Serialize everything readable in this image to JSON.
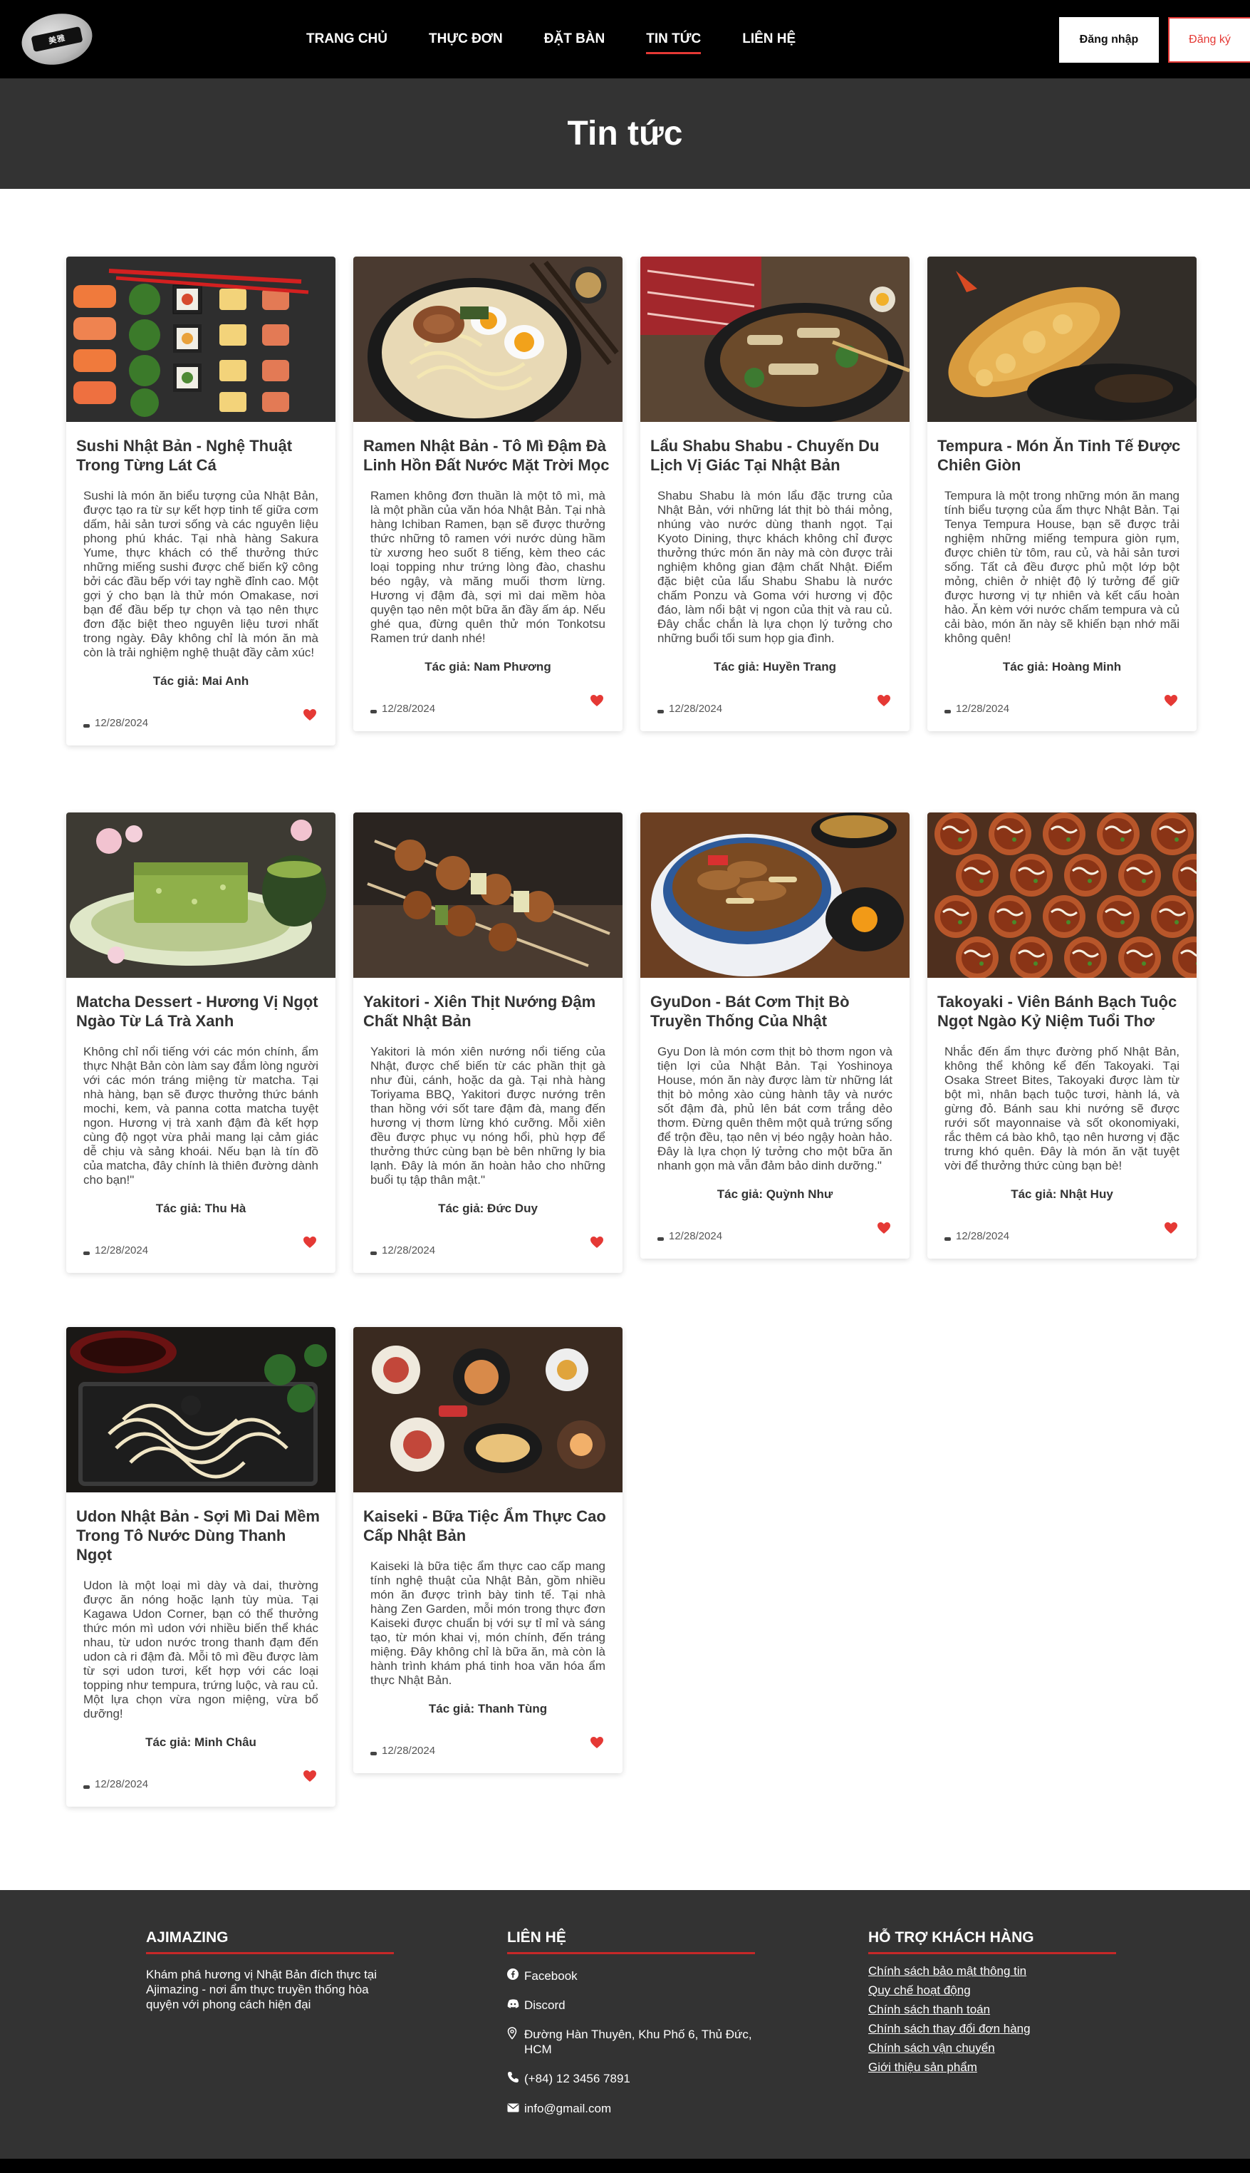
{
  "nav": {
    "logo_text": "美雅",
    "links": [
      "TRANG CHỦ",
      "THỰC ĐƠN",
      "ĐẶT BÀN",
      "TIN TỨC",
      "LIÊN HỆ"
    ],
    "active": "TIN TỨC",
    "login_label": "Đăng nhập",
    "register_label": "Đăng ký"
  },
  "hero": {
    "title": "Tin tức"
  },
  "colors": {
    "accent": "#e53935",
    "dark": "#333333",
    "black": "#000000"
  },
  "articles": [
    {
      "title": "Sushi Nhật Bản - Nghệ Thuật Trong Từng Lát Cá",
      "desc": "Sushi là món ăn biểu tượng của Nhật Bản, được tạo ra từ sự kết hợp tinh tế giữa cơm dấm, hải sản tươi sống và các nguyên liệu phong phú khác. Tại nhà hàng Sakura Yume, thực khách có thể thưởng thức những miếng sushi được chế biến kỹ công bởi các đầu bếp với tay nghề đỉnh cao. Một gợi ý cho bạn là thử món Omakase, nơi bạn để đầu bếp tự chọn và tạo nên thực đơn đặc biệt theo nguyên liệu tươi nhất trong ngày. Đây không chỉ là món ăn mà còn là trải nghiệm nghệ thuật đầy cảm xúc!",
      "author": "Tác giả: Mai Anh",
      "date": "12/28/2024",
      "image": "sushi-platter"
    },
    {
      "title": "Ramen Nhật Bản - Tô Mì Đậm Đà Linh Hồn Đất Nước Mặt Trời Mọc",
      "desc": "Ramen không đơn thuần là một tô mì, mà là một phần của văn hóa Nhật Bản. Tại nhà hàng Ichiban Ramen, bạn sẽ được thưởng thức những tô ramen với nước dùng hầm từ xương heo suốt 8 tiếng, kèm theo các loại topping như trứng lòng đào, chashu béo ngậy, và măng muối thơm lừng. Hương vị đậm đà, sợi mì dai mềm hòa quyện tạo nên một bữa ăn đầy ấm áp. Nếu ghé qua, đừng quên thử món Tonkotsu Ramen trứ danh nhé!",
      "author": "Tác giả: Nam Phương",
      "date": "12/28/2024",
      "image": "ramen-bowl"
    },
    {
      "title": "Lẩu Shabu Shabu - Chuyến Du Lịch Vị Giác Tại Nhật Bản",
      "desc": "Shabu Shabu là món lẩu đặc trưng của Nhật Bản, với những lát thịt bò thái mỏng, nhúng vào nước dùng thanh ngọt. Tại Kyoto Dining, thực khách không chỉ được thưởng thức món ăn này mà còn được trải nghiệm không gian đậm chất Nhật. Điểm đặc biệt của lẩu Shabu Shabu là nước chấm Ponzu và Goma với hương vị độc đáo, làm nổi bật vị ngon của thịt và rau củ. Đây chắc chắn là lựa chọn lý tưởng cho những buổi tối sum họp gia đình.",
      "author": "Tác giả: Huyền Trang",
      "date": "12/28/2024",
      "image": "shabu-hotpot"
    },
    {
      "title": "Tempura - Món Ăn Tinh Tế Được Chiên Giòn",
      "desc": "Tempura là một trong những món ăn mang tính biểu tượng của ẩm thực Nhật Bản. Tại Tenya Tempura House, bạn sẽ được trải nghiệm những miếng tempura giòn rụm, được chiên từ tôm, rau củ, và hải sản tươi sống. Tất cả đều được phủ một lớp bột mỏng, chiên ở nhiệt độ lý tưởng để giữ được hương vị tự nhiên và kết cấu hoàn hảo. Ăn kèm với nước chấm tempura và củ cải bào, món ăn này sẽ khiến bạn nhớ mãi không quên!",
      "author": "Tác giả: Hoàng Minh",
      "date": "12/28/2024",
      "image": "tempura-shrimp"
    },
    {
      "title": "Matcha Dessert - Hương Vị Ngọt Ngào Từ Lá Trà Xanh",
      "desc": "Không chỉ nổi tiếng với các món chính, ẩm thực Nhật Bản còn làm say đắm lòng người với các món tráng miệng từ matcha. Tại nhà hàng, bạn sẽ được thưởng thức bánh mochi, kem, và panna cotta matcha tuyệt ngon. Hương vị trà xanh đậm đà kết hợp cùng độ ngọt vừa phải mang lại cảm giác dễ chịu và sảng khoái. Nếu bạn là tín đồ của matcha, đây chính là thiên đường dành cho bạn!\"",
      "author": "Tác giả: Thu Hà",
      "date": "12/28/2024",
      "image": "matcha-cake"
    },
    {
      "title": "Yakitori - Xiên Thịt Nướng Đậm Chất Nhật Bản",
      "desc": "Yakitori là món xiên nướng nổi tiếng của Nhật, được chế biến từ các phần thịt gà như đùi, cánh, hoặc da gà. Tại nhà hàng Toriyama BBQ, Yakitori được nướng trên than hồng với sốt tare đậm đà, mang đến hương vị thơm lừng khó cưỡng. Mỗi xiên đều được phục vụ nóng hổi, phù hợp để thưởng thức cùng bạn bè bên những ly bia lạnh. Đây là món ăn hoàn hảo cho những buổi tụ tập thân mật.\"",
      "author": "Tác giả: Đức Duy",
      "date": "12/28/2024",
      "image": "yakitori-skewers"
    },
    {
      "title": "GyuDon - Bát Cơm Thịt Bò Truyền Thống Của Nhật",
      "desc": "Gyu Don là món cơm thịt bò thơm ngon và tiện lợi của Nhật Bản. Tại Yoshinoya House, món ăn này được làm từ những lát thịt bò mỏng xào cùng hành tây và nước sốt đậm đà, phủ lên bát cơm trắng dẻo thơm. Đừng quên thêm một quả trứng sống để trộn đều, tạo nên vị béo ngậy hoàn hảo. Đây là lựa chọn lý tưởng cho một bữa ăn nhanh gọn mà vẫn đảm bảo dinh dưỡng.\"",
      "author": "Tác giả: Quỳnh Như",
      "date": "12/28/2024",
      "image": "gyudon-bowl"
    },
    {
      "title": "Takoyaki - Viên Bánh Bạch Tuộc Ngọt Ngào Kỷ Niệm Tuổi Thơ",
      "desc": "Nhắc đến ẩm thực đường phố Nhật Bản, không thể không kể đến Takoyaki. Tại Osaka Street Bites, Takoyaki được làm từ bột mì, nhân bạch tuộc tươi, hành lá, và gừng đỏ. Bánh sau khi nướng sẽ được rưới sốt mayonnaise và sốt okonomiyaki, rắc thêm cá bào khô, tạo nên hương vị đặc trưng khó quên. Đây là món ăn vặt tuyệt vời để thưởng thức cùng bạn bè!",
      "author": "Tác giả: Nhật Huy",
      "date": "12/28/2024",
      "image": "takoyaki-balls"
    },
    {
      "title": "Udon Nhật Bản - Sợi Mì Dai Mềm Trong Tô Nước Dùng Thanh Ngọt",
      "desc": "Udon là một loại mì dày và dai, thường được ăn nóng hoặc lạnh tùy mùa. Tại Kagawa Udon Corner, bạn có thể thưởng thức món mì udon với nhiều biến thể khác nhau, từ udon nước trong thanh đạm đến udon cà ri đậm đà. Mỗi tô mì đều được làm từ sợi udon tươi, kết hợp với các loại topping như tempura, trứng luộc, và rau củ. Một lựa chọn vừa ngon miệng, vừa bổ dưỡng!",
      "author": "Tác giả: Minh Châu",
      "date": "12/28/2024",
      "image": "udon-noodles"
    },
    {
      "title": "Kaiseki - Bữa Tiệc Ẩm Thực Cao Cấp Nhật Bản",
      "desc": "Kaiseki là bữa tiệc ẩm thực cao cấp mang tính nghệ thuật của Nhật Bản, gồm nhiều món ăn được trình bày tinh tế. Tại nhà hàng Zen Garden, mỗi món trong thực đơn Kaiseki được chuẩn bị với sự tỉ mỉ và sáng tạo, từ món khai vị, món chính, đến tráng miệng. Đây không chỉ là bữa ăn, mà còn là hành trình khám phá tinh hoa văn hóa ẩm thực Nhật Bản.",
      "author": "Tác giả: Thanh Tùng",
      "date": "12/28/2024",
      "image": "kaiseki-spread"
    }
  ],
  "footer": {
    "about": {
      "heading": "AJIMAZING",
      "text": "Khám phá hương vị Nhật Bản đích thực tại Ajimazing - nơi ẩm thực truyền thống hòa quyện với phong cách hiện đại"
    },
    "contact": {
      "heading": "LIÊN HỆ",
      "items": [
        {
          "icon": "facebook-icon",
          "text": "Facebook"
        },
        {
          "icon": "discord-icon",
          "text": "Discord"
        },
        {
          "icon": "location-icon",
          "text": "Đường Hàn Thuyên, Khu Phố 6, Thủ Đức, HCM"
        },
        {
          "icon": "phone-icon",
          "text": "(+84) 12 3456 7891"
        },
        {
          "icon": "mail-icon",
          "text": "info@gmail.com"
        }
      ]
    },
    "support": {
      "heading": "HỖ TRỢ KHÁCH HÀNG",
      "links": [
        "Chính sách bảo mật thông tin",
        "Quy chế hoạt động",
        "Chính sách thanh toán",
        "Chính sách thay đổi đơn hàng",
        "Chính sách vận chuyển",
        "Giới thiệu sản phẩm"
      ]
    }
  }
}
